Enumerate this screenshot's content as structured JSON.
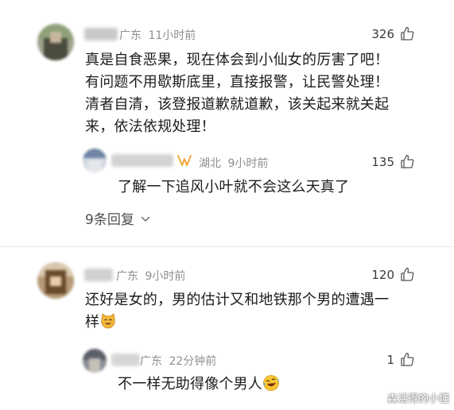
{
  "comments": [
    {
      "location": "广东",
      "time": "11小时前",
      "likes": "326",
      "lines": [
        "真是自食恶果，现在体会到小仙女的厉害了吧！",
        "有问题不用歇斯底里，直接报警，让民警处理！",
        "清者自清，该登报道歉就道歉，该关起来就关起",
        "来，依法依规处理！"
      ],
      "reply": {
        "location": "湖北",
        "time": "9小时前",
        "likes": "135",
        "text": "了解一下追风小叶就不会这么天真了"
      },
      "more_replies": "9条回复"
    },
    {
      "location": "广东",
      "time": "9小时前",
      "likes": "120",
      "lines": [
        "还好是女的，男的估计又和地铁那个男的遭遇一",
        "样"
      ],
      "reply": {
        "location": "广东",
        "time": "22分钟前",
        "likes": "1",
        "text": "不一样无助得像个男人"
      }
    }
  ],
  "icons": {
    "like": "thumbs-up-icon",
    "member_badge": "v-member-badge-icon",
    "chevron": "chevron-down-icon",
    "emoji_cat": "cat-face-emoji-icon",
    "emoji_laugh": "laughing-crying-emoji-icon"
  },
  "colors": {
    "meta_text": "#8f8f8f",
    "badge": "#f0a93b"
  },
  "watermark": "森活得的小懂"
}
